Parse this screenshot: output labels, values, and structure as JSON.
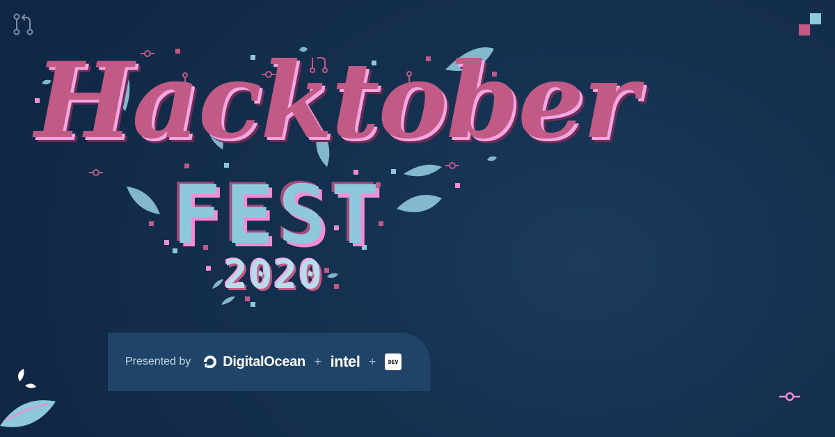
{
  "colors": {
    "background": "#15304f",
    "accent_pink": "#f48ad8",
    "accent_maroon": "#c25a86",
    "accent_blue": "#8ec8dc",
    "panel": "#1f4467"
  },
  "hero": {
    "title_word": "Hacktober",
    "fest_word": "FEST",
    "year": "2020"
  },
  "sponsors": {
    "presented_label": "Presented by",
    "digitalocean": "DigitalOcean",
    "separator": "+",
    "intel": "intel",
    "dev": "DEV"
  },
  "icons": {
    "top_left": "git-pull-request-icon",
    "top_right": "pixel-squares-icon",
    "bottom_left": "leaf-icon",
    "bottom_right": "git-commit-icon"
  }
}
